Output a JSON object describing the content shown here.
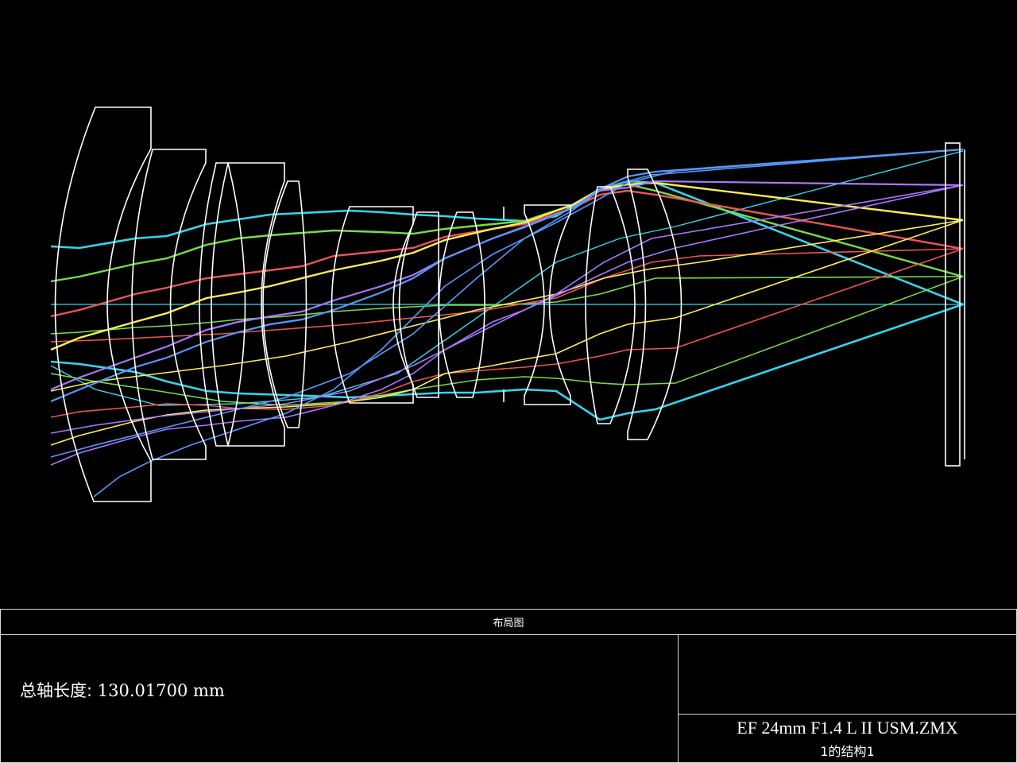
{
  "title": "布局图",
  "axial_length_label": "总轴长度:",
  "axial_length_value": "130.01700 mm",
  "file_name": "EF 24mm F1.4 L II USM.ZMX",
  "configuration_label": "1的结构1",
  "colors": {
    "background": "#000000",
    "lens_outline": "#ffffff",
    "border": "#d9d9d9",
    "ray_field_1": "#33d6ee",
    "ray_field_2": "#77dd44",
    "ray_field_3": "#ee5555",
    "ray_field_4": "#ffee55",
    "ray_field_5": "#aa77ff",
    "ray_field_6": "#5599ff"
  }
}
